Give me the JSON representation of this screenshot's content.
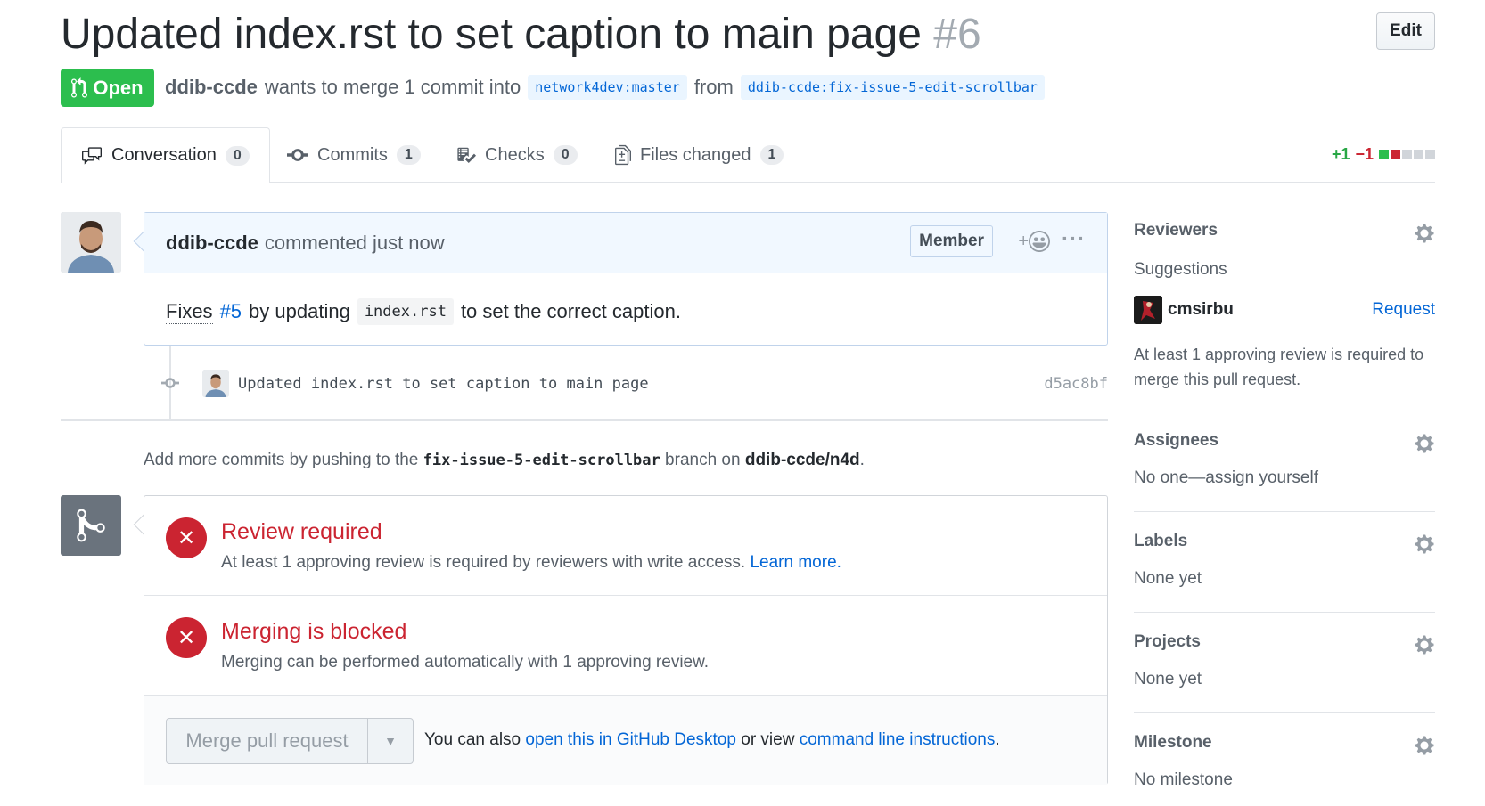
{
  "header": {
    "title": "Updated index.rst to set caption to main page",
    "number": "#6",
    "edit_label": "Edit",
    "state_label": "Open",
    "author": "ddib-ccde",
    "meta_text": "wants to merge 1 commit into",
    "base_branch": "network4dev:master",
    "from_text": "from",
    "head_branch": "ddib-ccde:fix-issue-5-edit-scrollbar"
  },
  "tabs": [
    {
      "label": "Conversation",
      "count": "0",
      "icon": "comment-discussion-icon"
    },
    {
      "label": "Commits",
      "count": "1",
      "icon": "git-commit-icon"
    },
    {
      "label": "Checks",
      "count": "0",
      "icon": "checklist-icon"
    },
    {
      "label": "Files changed",
      "count": "1",
      "icon": "file-diff-icon"
    }
  ],
  "diffstat": {
    "additions": "+1",
    "deletions": "−1",
    "blocks": [
      "#2cbe4e",
      "#cb2431",
      "#d1d5da",
      "#d1d5da",
      "#d1d5da"
    ]
  },
  "comment": {
    "author": "ddib-ccde",
    "action_text": "commented just now",
    "badge": "Member",
    "reaction_plus": "+",
    "more": "···",
    "body_fixes": "Fixes",
    "body_issue": "#5",
    "body_mid": "by updating",
    "body_code": "index.rst",
    "body_end": "to set the correct caption."
  },
  "commit": {
    "message": "Updated index.rst to set caption to main page",
    "sha": "d5ac8bf"
  },
  "push_hint": {
    "prefix": "Add more commits by pushing to the",
    "branch": "fix-issue-5-edit-scrollbar",
    "middle": "branch on",
    "repo": "ddib-ccde/n4d",
    "suffix": "."
  },
  "merge": {
    "review_title": "Review required",
    "review_desc": "At least 1 approving review is required by reviewers with write access.",
    "review_link": "Learn more.",
    "blocked_title": "Merging is blocked",
    "blocked_desc": "Merging can be performed automatically with 1 approving review.",
    "button_label": "Merge pull request",
    "alt_prefix": "You can also",
    "alt_link1": "open this in GitHub Desktop",
    "alt_middle": "or view",
    "alt_link2": "command line instructions",
    "alt_suffix": "."
  },
  "sidebar": {
    "reviewers": {
      "heading": "Reviewers",
      "suggestions_label": "Suggestions",
      "suggested_user": "cmsirbu",
      "request_label": "Request",
      "note": "At least 1 approving review is required to merge this pull request."
    },
    "assignees": {
      "heading": "Assignees",
      "text": "No one—assign yourself"
    },
    "labels": {
      "heading": "Labels",
      "text": "None yet"
    },
    "projects": {
      "heading": "Projects",
      "text": "None yet"
    },
    "milestone": {
      "heading": "Milestone",
      "text": "No milestone"
    }
  },
  "colors": {
    "open_green": "#2cbe4e",
    "error_red": "#cb2431",
    "link_blue": "#0366d6"
  }
}
